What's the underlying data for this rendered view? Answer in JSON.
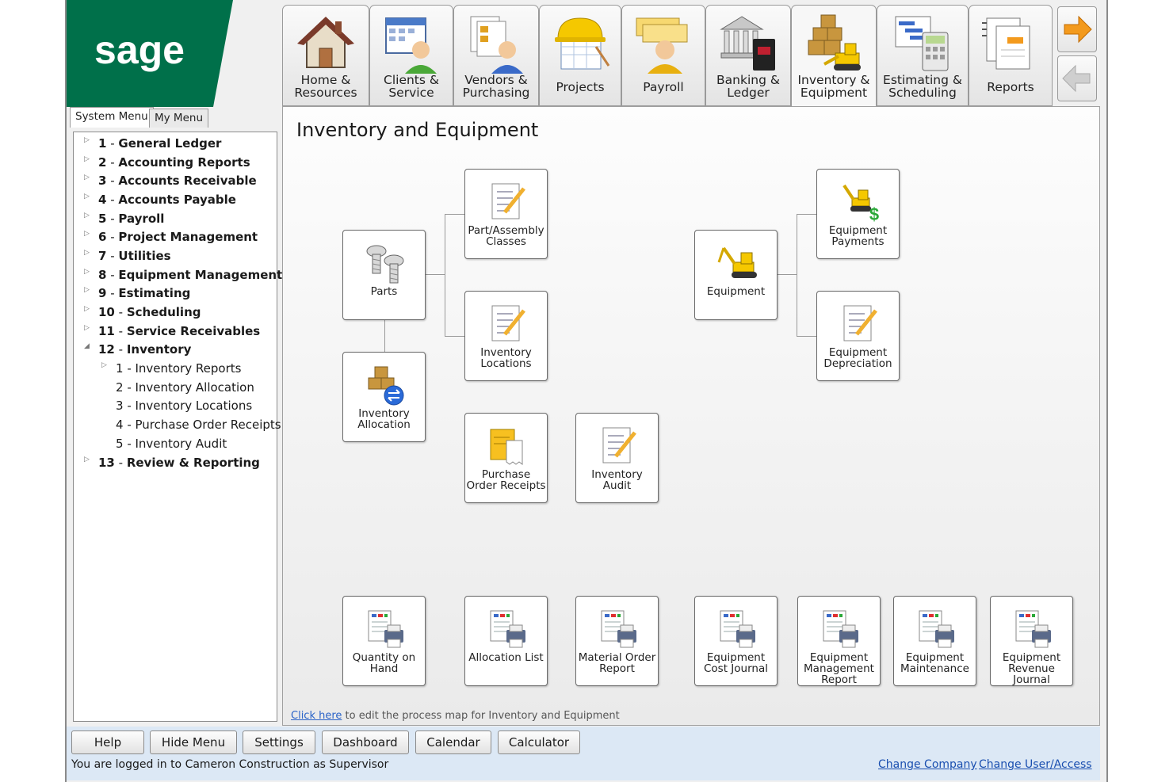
{
  "logo_text": "sage",
  "tabs": [
    {
      "label": "Home &\nResources",
      "icon": "house-icon"
    },
    {
      "label": "Clients &\nService",
      "icon": "clients-icon"
    },
    {
      "label": "Vendors &\nPurchasing",
      "icon": "vendors-icon"
    },
    {
      "label": "Projects",
      "icon": "hardhat-icon"
    },
    {
      "label": "Payroll",
      "icon": "payroll-icon"
    },
    {
      "label": "Banking &\nLedger",
      "icon": "bank-icon"
    },
    {
      "label": "Inventory &\nEquipment",
      "icon": "inventory-icon"
    },
    {
      "label": "Estimating &\nScheduling",
      "icon": "estimating-icon"
    },
    {
      "label": "Reports",
      "icon": "reports-icon"
    }
  ],
  "nav_arrows": {
    "forward": "forward-arrow-icon",
    "back": "back-arrow-icon"
  },
  "menu_tabs": {
    "system": "System Menu",
    "my": "My Menu"
  },
  "tree": [
    {
      "num": "1",
      "label": "General Ledger"
    },
    {
      "num": "2",
      "label": "Accounting Reports"
    },
    {
      "num": "3",
      "label": "Accounts Receivable"
    },
    {
      "num": "4",
      "label": "Accounts Payable"
    },
    {
      "num": "5",
      "label": "Payroll"
    },
    {
      "num": "6",
      "label": "Project Management"
    },
    {
      "num": "7",
      "label": "Utilities"
    },
    {
      "num": "8",
      "label": "Equipment Management"
    },
    {
      "num": "9",
      "label": "Estimating"
    },
    {
      "num": "10",
      "label": "Scheduling"
    },
    {
      "num": "11",
      "label": "Service Receivables"
    },
    {
      "num": "12",
      "label": "Inventory"
    },
    {
      "num": "13",
      "label": "Review & Reporting"
    }
  ],
  "subtree": [
    {
      "num": "1",
      "label": "Inventory Reports"
    },
    {
      "num": "2",
      "label": "Inventory Allocation"
    },
    {
      "num": "3",
      "label": "Inventory Locations"
    },
    {
      "num": "4",
      "label": "Purchase Order Receipts"
    },
    {
      "num": "5",
      "label": "Inventory Audit"
    }
  ],
  "page_title": "Inventory and Equipment",
  "nodes": {
    "parts": "Parts",
    "part_classes": "Part/Assembly\nClasses",
    "inv_locations": "Inventory\nLocations",
    "inv_allocation": "Inventory\nAllocation",
    "po_receipts": "Purchase\nOrder Receipts",
    "inv_audit": "Inventory\nAudit",
    "equipment": "Equipment",
    "equip_payments": "Equipment\nPayments",
    "equip_depreciation": "Equipment\nDepreciation"
  },
  "reports": [
    "Quantity on\nHand",
    "Allocation List",
    "Material Order\nReport",
    "Equipment\nCost Journal",
    "Equipment\nManagement\nReport",
    "Equipment\nMaintenance",
    "Equipment\nRevenue\nJournal"
  ],
  "click_here": {
    "link": "Click here",
    "rest": " to edit the process map for Inventory and Equipment"
  },
  "bottom_buttons": [
    "Help",
    "Hide Menu",
    "Settings",
    "Dashboard",
    "Calendar",
    "Calculator"
  ],
  "status": "You are logged in to Cameron Construction as Supervisor",
  "links": {
    "change_company": "Change Company",
    "change_user": "Change User/Access"
  },
  "colors": {
    "brand_green": "#00704a",
    "link_blue": "#1a4fb0",
    "accent_orange": "#f39a1d"
  }
}
